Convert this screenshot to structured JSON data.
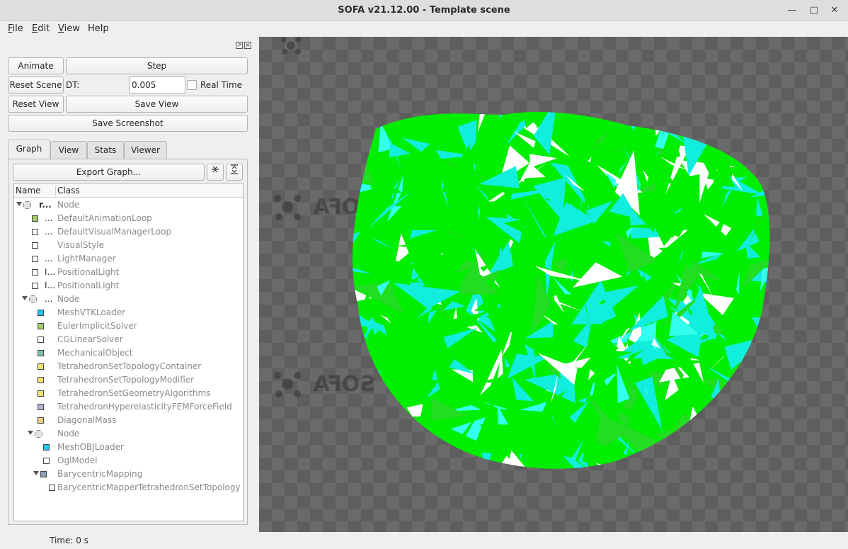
{
  "window": {
    "title": "SOFA v21.12.00 - Template scene"
  },
  "menubar": {
    "items": [
      {
        "label": "File",
        "ul": "F",
        "rest": "ile"
      },
      {
        "label": "Edit",
        "ul": "E",
        "rest": "dit"
      },
      {
        "label": "View",
        "ul": "V",
        "rest": "iew"
      },
      {
        "label": "Help",
        "ul": "",
        "rest": "Help"
      }
    ]
  },
  "controls": {
    "animate": "Animate",
    "step": "Step",
    "reset_scene": "Reset Scene",
    "dt_label": "DT:",
    "dt_value": "0.005",
    "real_time": "Real Time",
    "reset_view": "Reset View",
    "save_view": "Save View",
    "save_screenshot": "Save Screenshot"
  },
  "tabs": [
    "Graph",
    "View",
    "Stats",
    "Viewer"
  ],
  "graph": {
    "export_label": "Export Graph...",
    "col_name": "Name",
    "col_class": "Class",
    "rows": [
      {
        "name": "r...",
        "class": "Node",
        "kind": "node",
        "depth": 0,
        "expanded": true,
        "color": ""
      },
      {
        "name": "...",
        "class": "DefaultAnimationLoop",
        "kind": "comp",
        "depth": 1,
        "color": "#a6cc6a"
      },
      {
        "name": "...",
        "class": "DefaultVisualManagerLoop",
        "kind": "comp",
        "depth": 1,
        "color": "#ffffff"
      },
      {
        "name": "",
        "class": "VisualStyle",
        "kind": "comp",
        "depth": 1,
        "color": "#ffffff"
      },
      {
        "name": "...",
        "class": "LightManager",
        "kind": "comp",
        "depth": 1,
        "color": "#ffffff"
      },
      {
        "name": "I...",
        "class": "PositionalLight",
        "kind": "comp",
        "depth": 1,
        "color": "#ffffff"
      },
      {
        "name": "I...",
        "class": "PositionalLight",
        "kind": "comp",
        "depth": 1,
        "color": "#ffffff"
      },
      {
        "name": "...",
        "class": "Node",
        "kind": "node",
        "depth": 1,
        "expanded": true,
        "color": ""
      },
      {
        "name": "",
        "class": "MeshVTKLoader",
        "kind": "comp",
        "depth": 2,
        "color": "#1ec5f0"
      },
      {
        "name": "",
        "class": "EulerImplicitSolver",
        "kind": "comp",
        "depth": 2,
        "color": "#a6cc6a"
      },
      {
        "name": "",
        "class": "CGLinearSolver",
        "kind": "comp",
        "depth": 2,
        "color": "#ffffff"
      },
      {
        "name": "",
        "class": "MechanicalObject",
        "kind": "comp",
        "depth": 2,
        "color": "#7fc4a8"
      },
      {
        "name": "",
        "class": "TetrahedronSetTopologyContainer",
        "kind": "comp",
        "depth": 2,
        "color": "#f8e070"
      },
      {
        "name": "",
        "class": "TetrahedronSetTopologyModifier",
        "kind": "comp",
        "depth": 2,
        "color": "#f8e070"
      },
      {
        "name": "",
        "class": "TetrahedronSetGeometryAlgorithms",
        "kind": "comp",
        "depth": 2,
        "color": "#f8e070"
      },
      {
        "name": "",
        "class": "TetrahedronHyperelasticityFEMForceField",
        "kind": "comp",
        "depth": 2,
        "color": "#b6b0d8"
      },
      {
        "name": "",
        "class": "DiagonalMass",
        "kind": "comp",
        "depth": 2,
        "color": "#f0d080"
      },
      {
        "name": "",
        "class": "Node",
        "kind": "node",
        "depth": 2,
        "expanded": true,
        "color": ""
      },
      {
        "name": "",
        "class": "MeshOBJLoader",
        "kind": "comp",
        "depth": 3,
        "color": "#1ec5f0"
      },
      {
        "name": "",
        "class": "OglModel",
        "kind": "comp",
        "depth": 3,
        "color": "#ffffff"
      },
      {
        "name": "",
        "class": "BarycentricMapping",
        "kind": "mapping",
        "depth": 3,
        "expanded": true,
        "color": "#8aa0b8"
      },
      {
        "name": "",
        "class": "BarycentricMapperTetrahedronSetTopology",
        "kind": "comp",
        "depth": 4,
        "color": "#ffffff"
      }
    ]
  },
  "status": {
    "time": "Time: 0 s"
  },
  "viewport": {
    "logo_text": "SOFA",
    "mesh_colors": [
      "#00ee00",
      "#11eedd",
      "#ffffff",
      "#22dd22",
      "#33ffee"
    ]
  }
}
